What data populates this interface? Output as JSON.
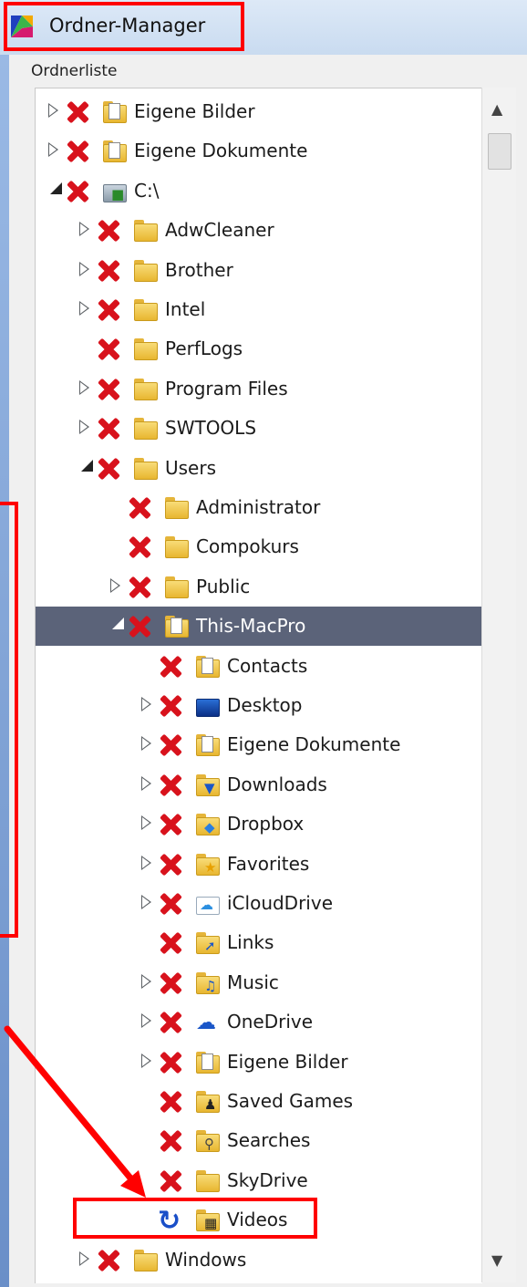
{
  "window": {
    "title": "Ordner-Manager"
  },
  "panel": {
    "label": "Ordnerliste"
  },
  "colors": {
    "highlight": "#ff0000",
    "selected_row": "#5b6379",
    "x_mark": "#d8121c"
  },
  "tree": [
    {
      "label": "Eigene Bilder",
      "level": 0,
      "expander": "closed",
      "status": "x-icon",
      "icon": "pictures-folder-icon"
    },
    {
      "label": "Eigene Dokumente",
      "level": 0,
      "expander": "closed",
      "status": "x-icon",
      "icon": "documents-folder-icon"
    },
    {
      "label": "C:\\",
      "level": 0,
      "expander": "open",
      "status": "x-icon",
      "icon": "drive-icon"
    },
    {
      "label": "AdwCleaner",
      "level": 1,
      "expander": "closed",
      "status": "x-icon",
      "icon": "folder-icon"
    },
    {
      "label": "Brother",
      "level": 1,
      "expander": "closed",
      "status": "x-icon",
      "icon": "folder-icon"
    },
    {
      "label": "Intel",
      "level": 1,
      "expander": "closed",
      "status": "x-icon",
      "icon": "folder-icon"
    },
    {
      "label": "PerfLogs",
      "level": 1,
      "expander": "none",
      "status": "x-icon",
      "icon": "folder-icon"
    },
    {
      "label": "Program Files",
      "level": 1,
      "expander": "closed",
      "status": "x-icon",
      "icon": "folder-icon"
    },
    {
      "label": "SWTOOLS",
      "level": 1,
      "expander": "closed",
      "status": "x-icon",
      "icon": "folder-icon"
    },
    {
      "label": "Users",
      "level": 1,
      "expander": "open",
      "status": "x-icon",
      "icon": "folder-icon"
    },
    {
      "label": "Administrator",
      "level": 2,
      "expander": "none",
      "status": "x-icon",
      "icon": "folder-icon"
    },
    {
      "label": "Compokurs",
      "level": 2,
      "expander": "none",
      "status": "x-icon",
      "icon": "folder-icon"
    },
    {
      "label": "Public",
      "level": 2,
      "expander": "closed",
      "status": "x-icon",
      "icon": "folder-icon"
    },
    {
      "label": "This-MacPro",
      "level": 2,
      "expander": "open",
      "status": "x-icon",
      "icon": "user-folder-icon",
      "selected": true
    },
    {
      "label": "Contacts",
      "level": 3,
      "expander": "none",
      "status": "x-icon",
      "icon": "contacts-folder-icon"
    },
    {
      "label": "Desktop",
      "level": 3,
      "expander": "closed",
      "status": "x-icon",
      "icon": "desktop-icon"
    },
    {
      "label": "Eigene Dokumente",
      "level": 3,
      "expander": "closed",
      "status": "x-icon",
      "icon": "documents-folder-icon"
    },
    {
      "label": "Downloads",
      "level": 3,
      "expander": "closed",
      "status": "x-icon",
      "icon": "downloads-folder-icon"
    },
    {
      "label": "Dropbox",
      "level": 3,
      "expander": "closed",
      "status": "x-icon",
      "icon": "dropbox-folder-icon"
    },
    {
      "label": "Favorites",
      "level": 3,
      "expander": "closed",
      "status": "x-icon",
      "icon": "favorites-folder-icon"
    },
    {
      "label": "iCloudDrive",
      "level": 3,
      "expander": "closed",
      "status": "x-icon",
      "icon": "icloud-icon"
    },
    {
      "label": "Links",
      "level": 3,
      "expander": "none",
      "status": "x-icon",
      "icon": "links-folder-icon"
    },
    {
      "label": "Music",
      "level": 3,
      "expander": "closed",
      "status": "x-icon",
      "icon": "music-folder-icon"
    },
    {
      "label": "OneDrive",
      "level": 3,
      "expander": "closed",
      "status": "x-icon",
      "icon": "onedrive-icon"
    },
    {
      "label": "Eigene Bilder",
      "level": 3,
      "expander": "closed",
      "status": "x-icon",
      "icon": "pictures-folder-icon"
    },
    {
      "label": "Saved Games",
      "level": 3,
      "expander": "none",
      "status": "x-icon",
      "icon": "saved-games-folder-icon"
    },
    {
      "label": "Searches",
      "level": 3,
      "expander": "none",
      "status": "x-icon",
      "icon": "searches-folder-icon"
    },
    {
      "label": "SkyDrive",
      "level": 3,
      "expander": "none",
      "status": "x-icon",
      "icon": "folder-icon"
    },
    {
      "label": "Videos",
      "level": 3,
      "expander": "none",
      "status": "refresh-icon",
      "icon": "videos-folder-icon"
    },
    {
      "label": "Windows",
      "level": 1,
      "expander": "closed",
      "status": "x-icon",
      "icon": "folder-icon"
    }
  ],
  "scrollbar": {
    "up_icon": "scroll-up-arrow-icon",
    "down_icon": "scroll-down-arrow-icon"
  }
}
